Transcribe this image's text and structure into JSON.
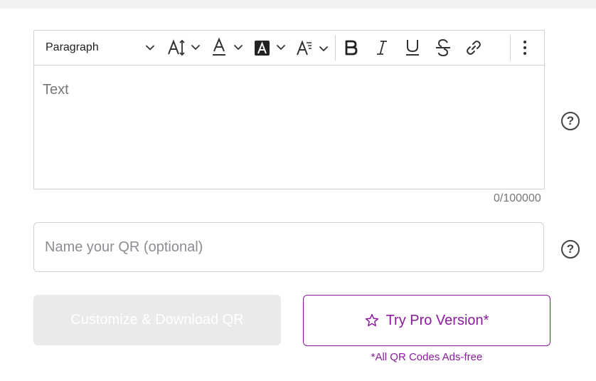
{
  "toolbar": {
    "paragraph_label": "Paragraph",
    "font_size_icon": "font-size-icon",
    "text_color_icon": "text-color-icon",
    "highlight_icon": "highlight-icon",
    "text_style_icon": "text-style-icon",
    "bold_icon": "bold-icon",
    "italic_icon": "italic-icon",
    "underline_icon": "underline-icon",
    "strikethrough_icon": "strikethrough-icon",
    "link_icon": "link-icon",
    "more_icon": "more-vertical-icon"
  },
  "editor": {
    "placeholder": "Text",
    "counter": "0/100000"
  },
  "name_field": {
    "placeholder": "Name your QR (optional)",
    "value": ""
  },
  "help": {
    "symbol": "?"
  },
  "buttons": {
    "customize_label": "Customize & Download QR",
    "pro_label": "Try Pro Version*",
    "pro_note": "*All QR Codes Ads-free"
  },
  "colors": {
    "accent": "#8b1a9e",
    "disabled_button": "#e9eaec",
    "border": "#cfd1d4"
  }
}
